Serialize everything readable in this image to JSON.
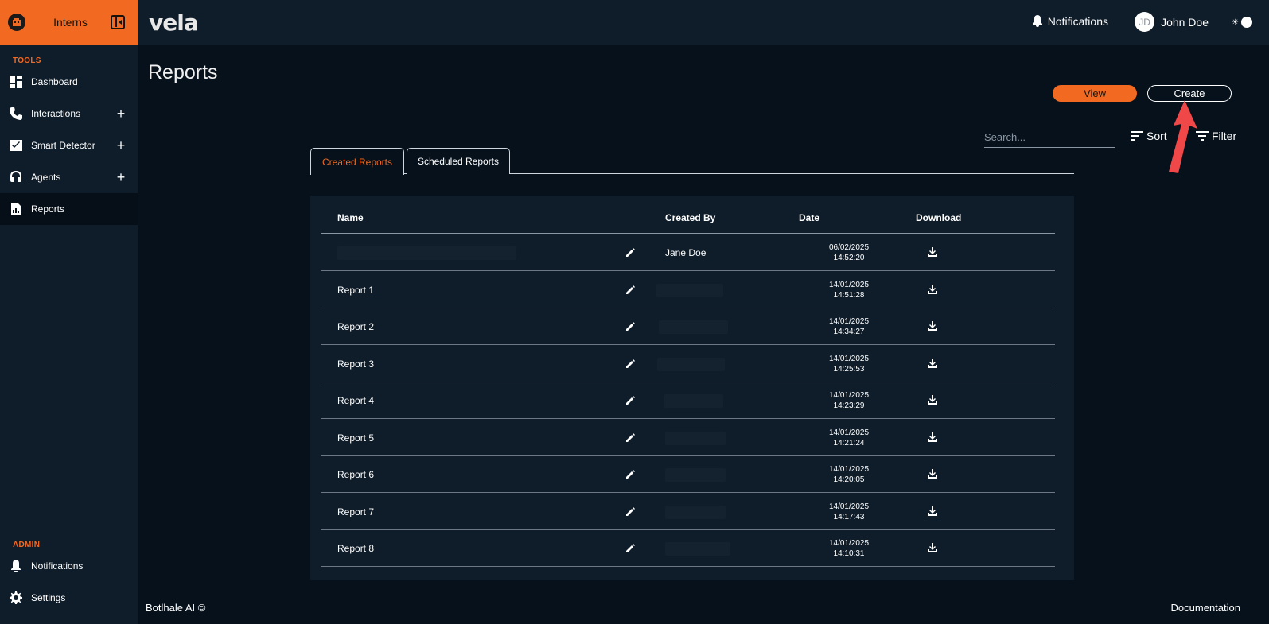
{
  "sidebar": {
    "brand": "Interns",
    "tools_label": "TOOLS",
    "tools": [
      {
        "label": "Dashboard",
        "icon": "dashboard-icon",
        "expandable": false
      },
      {
        "label": "Interactions",
        "icon": "phone-icon",
        "expandable": true
      },
      {
        "label": "Smart Detector",
        "icon": "smart-detector-icon",
        "expandable": true
      },
      {
        "label": "Agents",
        "icon": "headset-icon",
        "expandable": true
      },
      {
        "label": "Reports",
        "icon": "report-icon",
        "expandable": false,
        "active": true
      }
    ],
    "admin_label": "ADMIN",
    "admin": [
      {
        "label": "Notifications",
        "icon": "bell-icon"
      },
      {
        "label": "Settings",
        "icon": "gear-icon"
      }
    ]
  },
  "topbar": {
    "logo": "vela",
    "notifications_label": "Notifications",
    "user_initials": "JD",
    "user_name": "John Doe"
  },
  "page": {
    "title": "Reports",
    "view_label": "View",
    "create_label": "Create",
    "search_placeholder": "Search...",
    "sort_label": "Sort",
    "filter_label": "Filter",
    "tabs": [
      {
        "label": "Created Reports",
        "active": true
      },
      {
        "label": "Scheduled Reports",
        "active": false
      }
    ]
  },
  "table": {
    "headers": {
      "name": "Name",
      "created_by": "Created By",
      "date": "Date",
      "download": "Download"
    },
    "rows": [
      {
        "name": "",
        "created_by": "Jane Doe",
        "date": "06/02/2025",
        "time": "14:52:20"
      },
      {
        "name": "Report 1",
        "created_by": "",
        "date": "14/01/2025",
        "time": "14:51:28"
      },
      {
        "name": "Report 2",
        "created_by": "",
        "date": "14/01/2025",
        "time": "14:34:27"
      },
      {
        "name": "Report 3",
        "created_by": "",
        "date": "14/01/2025",
        "time": "14:25:53"
      },
      {
        "name": "Report 4",
        "created_by": "",
        "date": "14/01/2025",
        "time": "14:23:29"
      },
      {
        "name": "Report 5",
        "created_by": "",
        "date": "14/01/2025",
        "time": "14:21:24"
      },
      {
        "name": "Report 6",
        "created_by": "",
        "date": "14/01/2025",
        "time": "14:20:05"
      },
      {
        "name": "Report 7",
        "created_by": "",
        "date": "14/01/2025",
        "time": "14:17:43"
      },
      {
        "name": "Report 8",
        "created_by": "",
        "date": "14/01/2025",
        "time": "14:10:31"
      }
    ]
  },
  "footer": {
    "left": "Botlhale AI ©",
    "right": "Documentation"
  },
  "colors": {
    "accent": "#f26a21",
    "sidebar_bg": "#0f1d2a",
    "page_bg": "#06111b",
    "annotation_arrow": "#f04848"
  }
}
